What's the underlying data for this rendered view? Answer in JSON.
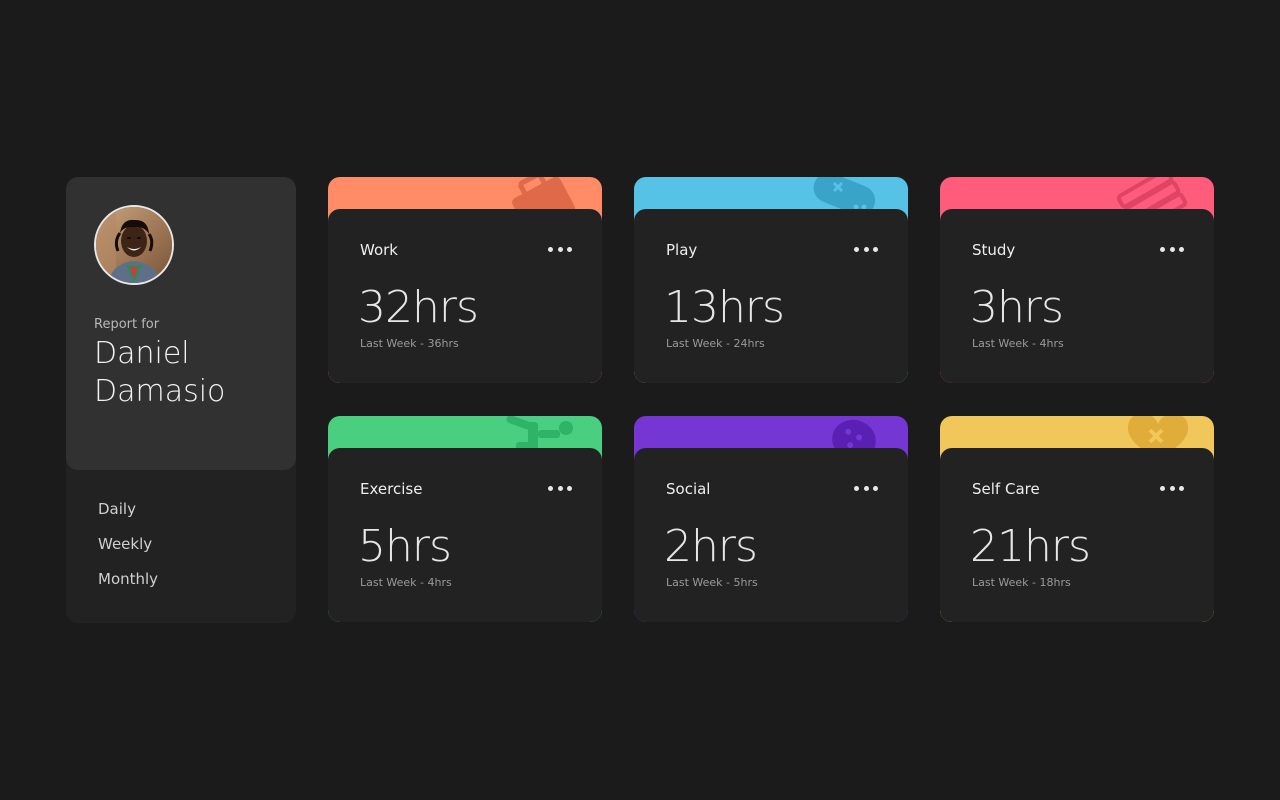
{
  "profile": {
    "report_for": "Report for",
    "name": "Daniel Damasio",
    "periods": [
      "Daily",
      "Weekly",
      "Monthly"
    ]
  },
  "activities": [
    {
      "title": "Work",
      "hours": "32hrs",
      "previous": "Last Week - 36hrs",
      "color": "#ff8c66",
      "icon": "briefcase-icon"
    },
    {
      "title": "Play",
      "hours": "13hrs",
      "previous": "Last Week - 24hrs",
      "color": "#56c2e6",
      "icon": "gamepad-icon"
    },
    {
      "title": "Study",
      "hours": "3hrs",
      "previous": "Last Week - 4hrs",
      "color": "#ff5c7c",
      "icon": "book-icon"
    },
    {
      "title": "Exercise",
      "hours": "5hrs",
      "previous": "Last Week - 4hrs",
      "color": "#4acf81",
      "icon": "running-icon"
    },
    {
      "title": "Social",
      "hours": "2hrs",
      "previous": "Last Week - 5hrs",
      "color": "#7536d3",
      "icon": "chat-bubble-icon"
    },
    {
      "title": "Self Care",
      "hours": "21hrs",
      "previous": "Last Week - 18hrs",
      "color": "#f1c65b",
      "icon": "heart-icon"
    }
  ]
}
